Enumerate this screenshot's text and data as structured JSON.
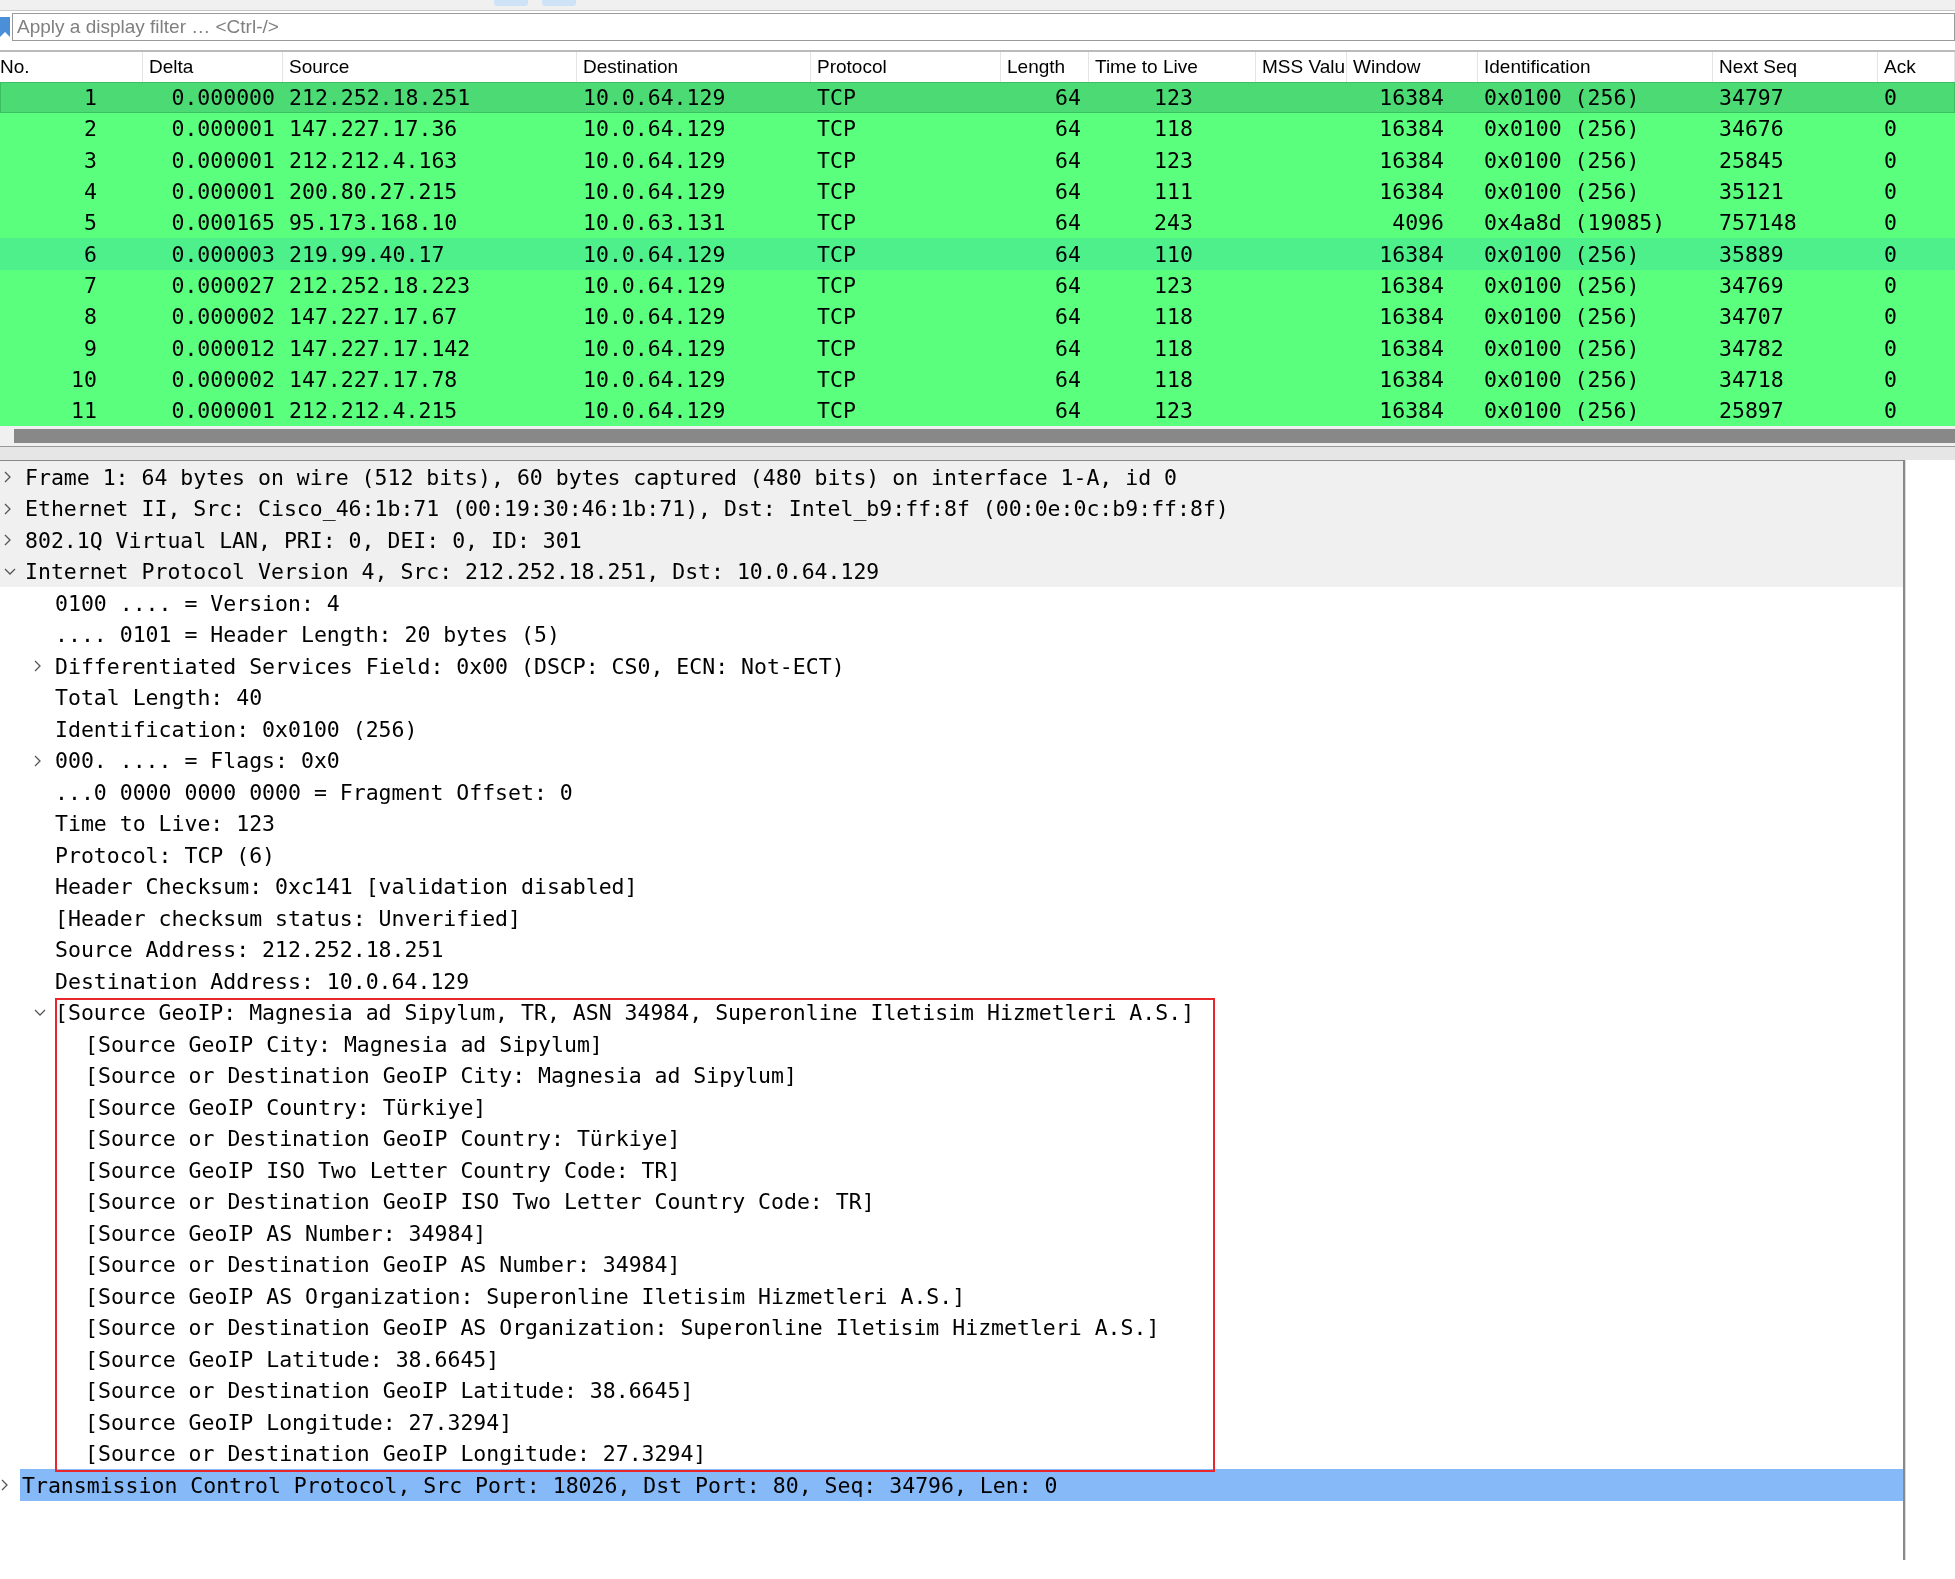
{
  "filter": {
    "placeholder": "Apply a display filter … <Ctrl-/>"
  },
  "columns": [
    {
      "label": "No."
    },
    {
      "label": "Delta"
    },
    {
      "label": "Source"
    },
    {
      "label": "Destination"
    },
    {
      "label": "Protocol"
    },
    {
      "label": "Length"
    },
    {
      "label": "Time to Live"
    },
    {
      "label": "MSS Valu"
    },
    {
      "label": "Window"
    },
    {
      "label": "Identification"
    },
    {
      "label": "Next Seq"
    },
    {
      "label": "Ack"
    }
  ],
  "packets": [
    {
      "selected": true,
      "color": "#4cda74",
      "cells": [
        "1",
        "0.000000",
        "212.252.18.251",
        "10.0.64.129",
        "TCP",
        "64",
        "123",
        "",
        "16384",
        "0x0100 (256)",
        "34797",
        "0"
      ]
    },
    {
      "selected": false,
      "color": "#5aff7e",
      "cells": [
        "2",
        "0.000001",
        "147.227.17.36",
        "10.0.64.129",
        "TCP",
        "64",
        "118",
        "",
        "16384",
        "0x0100 (256)",
        "34676",
        "0"
      ]
    },
    {
      "selected": false,
      "color": "#5aff7e",
      "cells": [
        "3",
        "0.000001",
        "212.212.4.163",
        "10.0.64.129",
        "TCP",
        "64",
        "123",
        "",
        "16384",
        "0x0100 (256)",
        "25845",
        "0"
      ]
    },
    {
      "selected": false,
      "color": "#5aff7e",
      "cells": [
        "4",
        "0.000001",
        "200.80.27.215",
        "10.0.64.129",
        "TCP",
        "64",
        "111",
        "",
        "16384",
        "0x0100 (256)",
        "35121",
        "0"
      ]
    },
    {
      "selected": false,
      "color": "#5aff7e",
      "cells": [
        "5",
        "0.000165",
        "95.173.168.10",
        "10.0.63.131",
        "TCP",
        "64",
        "243",
        "",
        "4096",
        "0x4a8d (19085)",
        "757148",
        "0"
      ]
    },
    {
      "selected": false,
      "color": "#4ef08c",
      "cells": [
        "6",
        "0.000003",
        "219.99.40.17",
        "10.0.64.129",
        "TCP",
        "64",
        "110",
        "",
        "16384",
        "0x0100 (256)",
        "35889",
        "0"
      ]
    },
    {
      "selected": false,
      "color": "#5aff7e",
      "cells": [
        "7",
        "0.000027",
        "212.252.18.223",
        "10.0.64.129",
        "TCP",
        "64",
        "123",
        "",
        "16384",
        "0x0100 (256)",
        "34769",
        "0"
      ]
    },
    {
      "selected": false,
      "color": "#5aff7e",
      "cells": [
        "8",
        "0.000002",
        "147.227.17.67",
        "10.0.64.129",
        "TCP",
        "64",
        "118",
        "",
        "16384",
        "0x0100 (256)",
        "34707",
        "0"
      ]
    },
    {
      "selected": false,
      "color": "#5aff7e",
      "cells": [
        "9",
        "0.000012",
        "147.227.17.142",
        "10.0.64.129",
        "TCP",
        "64",
        "118",
        "",
        "16384",
        "0x0100 (256)",
        "34782",
        "0"
      ]
    },
    {
      "selected": false,
      "color": "#5aff7e",
      "cells": [
        "10",
        "0.000002",
        "147.227.17.78",
        "10.0.64.129",
        "TCP",
        "64",
        "118",
        "",
        "16384",
        "0x0100 (256)",
        "34718",
        "0"
      ]
    },
    {
      "selected": false,
      "color": "#5aff7e",
      "cells": [
        "11",
        "0.000001",
        "212.212.4.215",
        "10.0.64.129",
        "TCP",
        "64",
        "123",
        "",
        "16384",
        "0x0100 (256)",
        "25897",
        "0"
      ]
    }
  ],
  "details": [
    {
      "text": "Frame 1: 64 bytes on wire (512 bits), 60 bytes captured (480 bits) on interface 1-A, id 0",
      "expanded": false,
      "selected": false
    },
    {
      "text": "Ethernet II, Src: Cisco_46:1b:71 (00:19:30:46:1b:71), Dst: Intel_b9:ff:8f (00:0e:0c:b9:ff:8f)",
      "expanded": false,
      "selected": false
    },
    {
      "text": "802.1Q Virtual LAN, PRI: 0, DEI: 0, ID: 301",
      "expanded": false,
      "selected": false
    },
    {
      "text": "Internet Protocol Version 4, Src: 212.252.18.251, Dst: 10.0.64.129",
      "expanded": true,
      "selected": false,
      "children": [
        {
          "text": "0100 .... = Version: 4",
          "selected": false
        },
        {
          "text": ".... 0101 = Header Length: 20 bytes (5)",
          "selected": false
        },
        {
          "text": "Differentiated Services Field: 0x00 (DSCP: CS0, ECN: Not-ECT)",
          "expanded": false,
          "selected": false
        },
        {
          "text": "Total Length: 40",
          "selected": false
        },
        {
          "text": "Identification: 0x0100 (256)",
          "selected": false
        },
        {
          "text": "000. .... = Flags: 0x0",
          "expanded": false,
          "selected": false
        },
        {
          "text": "...0 0000 0000 0000 = Fragment Offset: 0",
          "selected": false
        },
        {
          "text": "Time to Live: 123",
          "selected": false
        },
        {
          "text": "Protocol: TCP (6)",
          "selected": false
        },
        {
          "text": "Header Checksum: 0xc141 [validation disabled]",
          "selected": false
        },
        {
          "text": "[Header checksum status: Unverified]",
          "selected": false
        },
        {
          "text": "Source Address: 212.252.18.251",
          "selected": false
        },
        {
          "text": "Destination Address: 10.0.64.129",
          "selected": false
        },
        {
          "text": "[Source GeoIP: Magnesia ad Sipylum, TR, ASN 34984, Superonline Iletisim Hizmetleri A.S.]",
          "expanded": true,
          "selected": false,
          "highlighted": true,
          "children": [
            {
              "text": "[Source GeoIP City: Magnesia ad Sipylum]",
              "selected": false
            },
            {
              "text": "[Source or Destination GeoIP City: Magnesia ad Sipylum]",
              "selected": false
            },
            {
              "text": "[Source GeoIP Country: Türkiye]",
              "selected": false
            },
            {
              "text": "[Source or Destination GeoIP Country: Türkiye]",
              "selected": false
            },
            {
              "text": "[Source GeoIP ISO Two Letter Country Code: TR]",
              "selected": false
            },
            {
              "text": "[Source or Destination GeoIP ISO Two Letter Country Code: TR]",
              "selected": false
            },
            {
              "text": "[Source GeoIP AS Number: 34984]",
              "selected": false
            },
            {
              "text": "[Source or Destination GeoIP AS Number: 34984]",
              "selected": false
            },
            {
              "text": "[Source GeoIP AS Organization: Superonline Iletisim Hizmetleri A.S.]",
              "selected": false
            },
            {
              "text": "[Source or Destination GeoIP AS Organization: Superonline Iletisim Hizmetleri A.S.]",
              "selected": false
            },
            {
              "text": "[Source GeoIP Latitude: 38.6645]",
              "selected": false
            },
            {
              "text": "[Source or Destination GeoIP Latitude: 38.6645]",
              "selected": false
            },
            {
              "text": "[Source GeoIP Longitude: 27.3294]",
              "selected": false
            },
            {
              "text": "[Source or Destination GeoIP Longitude: 27.3294]",
              "selected": false
            }
          ]
        }
      ]
    },
    {
      "text": "Transmission Control Protocol, Src Port: 18026, Dst Port: 80, Seq: 34796, Len: 0",
      "expanded": false,
      "selected": true
    }
  ]
}
